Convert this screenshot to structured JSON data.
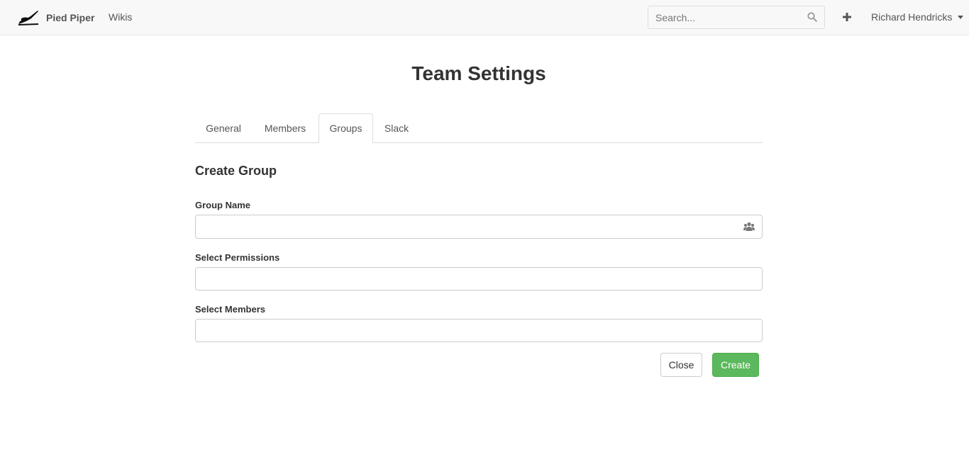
{
  "navbar": {
    "brand": "Pied Piper",
    "links": [
      "Wikis"
    ],
    "search": {
      "placeholder": "Search...",
      "value": ""
    },
    "user": "Richard Hendricks",
    "icons": {
      "logo": "pied-piper-logo",
      "search": "search-icon",
      "add": "plus-icon",
      "menu": "caret-down-icon"
    }
  },
  "page": {
    "title": "Team Settings",
    "tabs": [
      {
        "label": "General",
        "active": false
      },
      {
        "label": "Members",
        "active": false
      },
      {
        "label": "Groups",
        "active": true
      },
      {
        "label": "Slack",
        "active": false
      }
    ]
  },
  "form": {
    "title": "Create Group",
    "fields": [
      {
        "label": "Group Name",
        "value": "",
        "icon": "users-icon"
      },
      {
        "label": "Select Permissions",
        "value": ""
      },
      {
        "label": "Select Members",
        "value": ""
      }
    ],
    "buttons": {
      "close": "Close",
      "create": "Create"
    }
  },
  "colors": {
    "navbar_bg": "#f8f8f8",
    "primary_button": "#5cb85c",
    "text": "#333333",
    "muted_text": "#555555",
    "border": "#cccccc"
  }
}
